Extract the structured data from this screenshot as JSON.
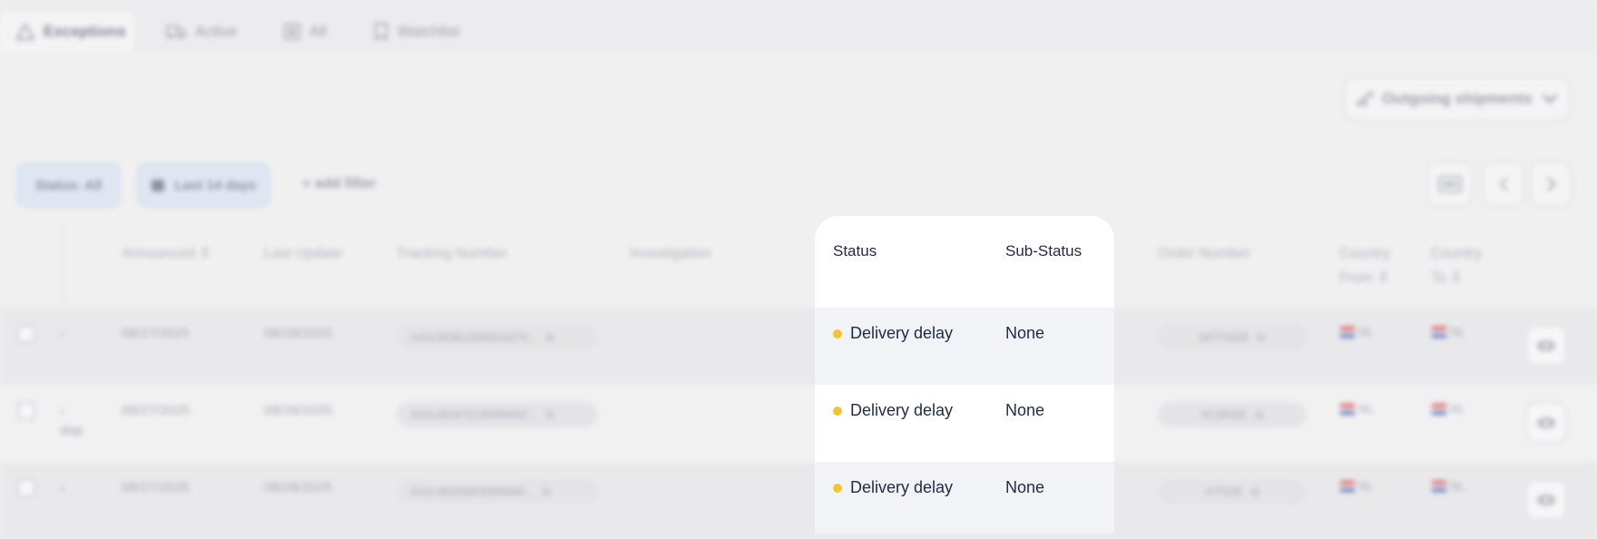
{
  "tabs": [
    {
      "label": "Exceptions",
      "icon": "warning-icon"
    },
    {
      "label": "Active",
      "icon": "truck-icon"
    },
    {
      "label": "All",
      "icon": "list-icon"
    },
    {
      "label": "Watchlist",
      "icon": "bookmark-icon"
    }
  ],
  "shipments_select": {
    "label": "Outgoing shipments"
  },
  "filters": {
    "status": "Status: All",
    "date": "Last 14 days",
    "add": "+ add filter"
  },
  "columns": {
    "announced": "Announced",
    "last_update": "Last Update",
    "tracking": "Tracking Number",
    "investigation": "Investigation",
    "status": "Status",
    "sub_status": "Sub-Status",
    "order": "Order Number",
    "country_from_1": "Country",
    "country_from_2": "From",
    "country_to_1": "Country",
    "country_to_2": "To",
    "sort_glyph": "⇕"
  },
  "rows": [
    {
      "frag": "‹",
      "frag2": "",
      "announced": "08/27/2025",
      "last_update": "08/28/2025",
      "tracking": "JVGL06361250001627б...",
      "status": "Delivery delay",
      "sub_status": "None",
      "order": "84774209",
      "from": "NL",
      "to": "NL"
    },
    {
      "frag": "‹",
      "frag2": "dop",
      "announced": "08/27/2025",
      "last_update": "08/28/2025",
      "tracking": "JVGL06347213000945Z...",
      "status": "Delivery delay",
      "sub_status": "None",
      "order": "#C2802E",
      "from": "NL",
      "to": "NL"
    },
    {
      "frag": "‹",
      "frag2": "",
      "announced": "08/27/2025",
      "last_update": "08/28/2025",
      "tracking": "JVGL06333603000094Ï...",
      "status": "Delivery delay",
      "sub_status": "None",
      "order": "#77225",
      "from": "NL",
      "to": "NL"
    }
  ],
  "colors": {
    "status_dot": "#f4c430",
    "panel": "#ffffff",
    "row_alt": "#f1f3f7"
  }
}
